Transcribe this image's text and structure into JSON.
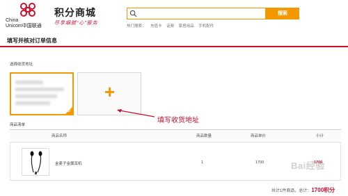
{
  "header": {
    "logo_line1": "China",
    "logo_line2": "Unicom中国联通",
    "brand_title": "积分商城",
    "brand_slogan": "尽享细腻“心”服务",
    "search": {
      "placeholder": "",
      "button_label": "搜索"
    },
    "hot_search": {
      "label": "热门搜索：",
      "items": [
        "充值卡",
        "话费",
        "家居用品",
        "手机配件"
      ]
    }
  },
  "page": {
    "title": "填写并核对订单信息"
  },
  "address": {
    "section_label": "选择收货地址",
    "annotation": "填写收货地址"
  },
  "products": {
    "section_label": "商品清单",
    "columns": [
      "商品名称",
      "商品数量",
      "商品单价",
      "小计"
    ],
    "rows": [
      {
        "name": "金麦子金属耳机",
        "quantity": "1",
        "unit_price": "1700",
        "subtotal": "1700"
      }
    ]
  },
  "summary": {
    "text": "共计1件商品，总计：",
    "total": "1700积分"
  },
  "watermark": "Bai经验",
  "colors": {
    "accent": "#f39800",
    "brand_red": "#c8102e"
  }
}
